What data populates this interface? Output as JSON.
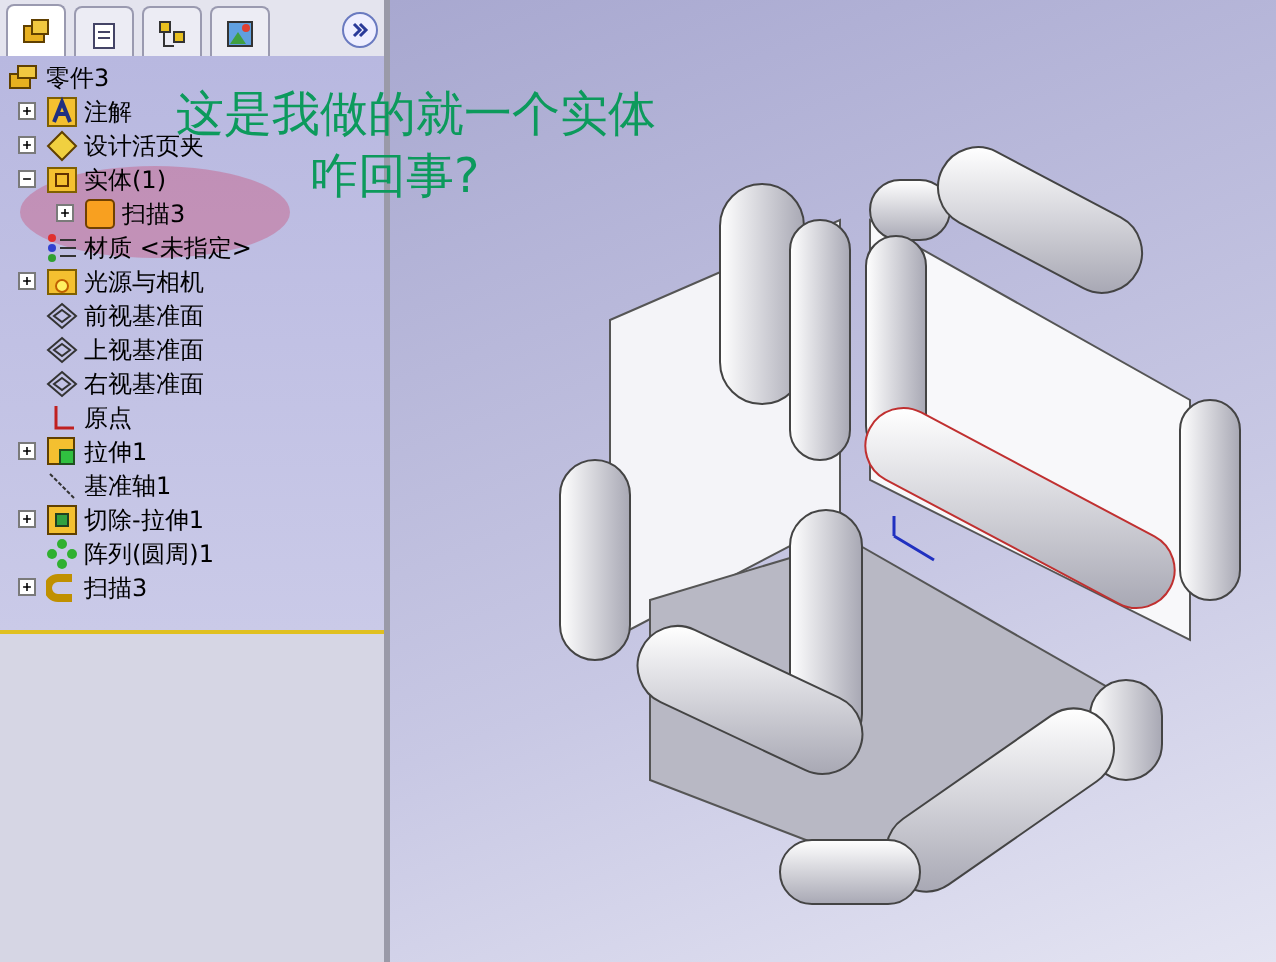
{
  "panel_tabs": [
    {
      "kind": "feature",
      "selected": true
    },
    {
      "kind": "property",
      "selected": false
    },
    {
      "kind": "config",
      "selected": false
    },
    {
      "kind": "display",
      "selected": false
    }
  ],
  "feature_tree": {
    "label": "零件3",
    "kind": "part",
    "children": [
      {
        "label": "注解",
        "kind": "annotation",
        "expanded": false
      },
      {
        "label": "设计活页夹",
        "kind": "binder",
        "expanded": false
      },
      {
        "label": "实体(1)",
        "kind": "bodies",
        "expanded": true,
        "children": [
          {
            "label": "扫描3",
            "kind": "body",
            "expanded": false
          }
        ]
      },
      {
        "label": "材质 <未指定>",
        "kind": "material"
      },
      {
        "label": "光源与相机",
        "kind": "lights",
        "expanded": false
      },
      {
        "label": "前视基准面",
        "kind": "plane"
      },
      {
        "label": "上视基准面",
        "kind": "plane"
      },
      {
        "label": "右视基准面",
        "kind": "plane"
      },
      {
        "label": "原点",
        "kind": "origin"
      },
      {
        "label": "拉伸1",
        "kind": "extrude",
        "expanded": false
      },
      {
        "label": "基准轴1",
        "kind": "axis"
      },
      {
        "label": "切除-拉伸1",
        "kind": "cut",
        "expanded": false
      },
      {
        "label": "阵列(圆周)1",
        "kind": "pattern"
      },
      {
        "label": "扫描3",
        "kind": "sweep",
        "expanded": false
      }
    ]
  },
  "annotation": {
    "lines": [
      "这是我做的就一个实体",
      "咋回事?"
    ]
  }
}
